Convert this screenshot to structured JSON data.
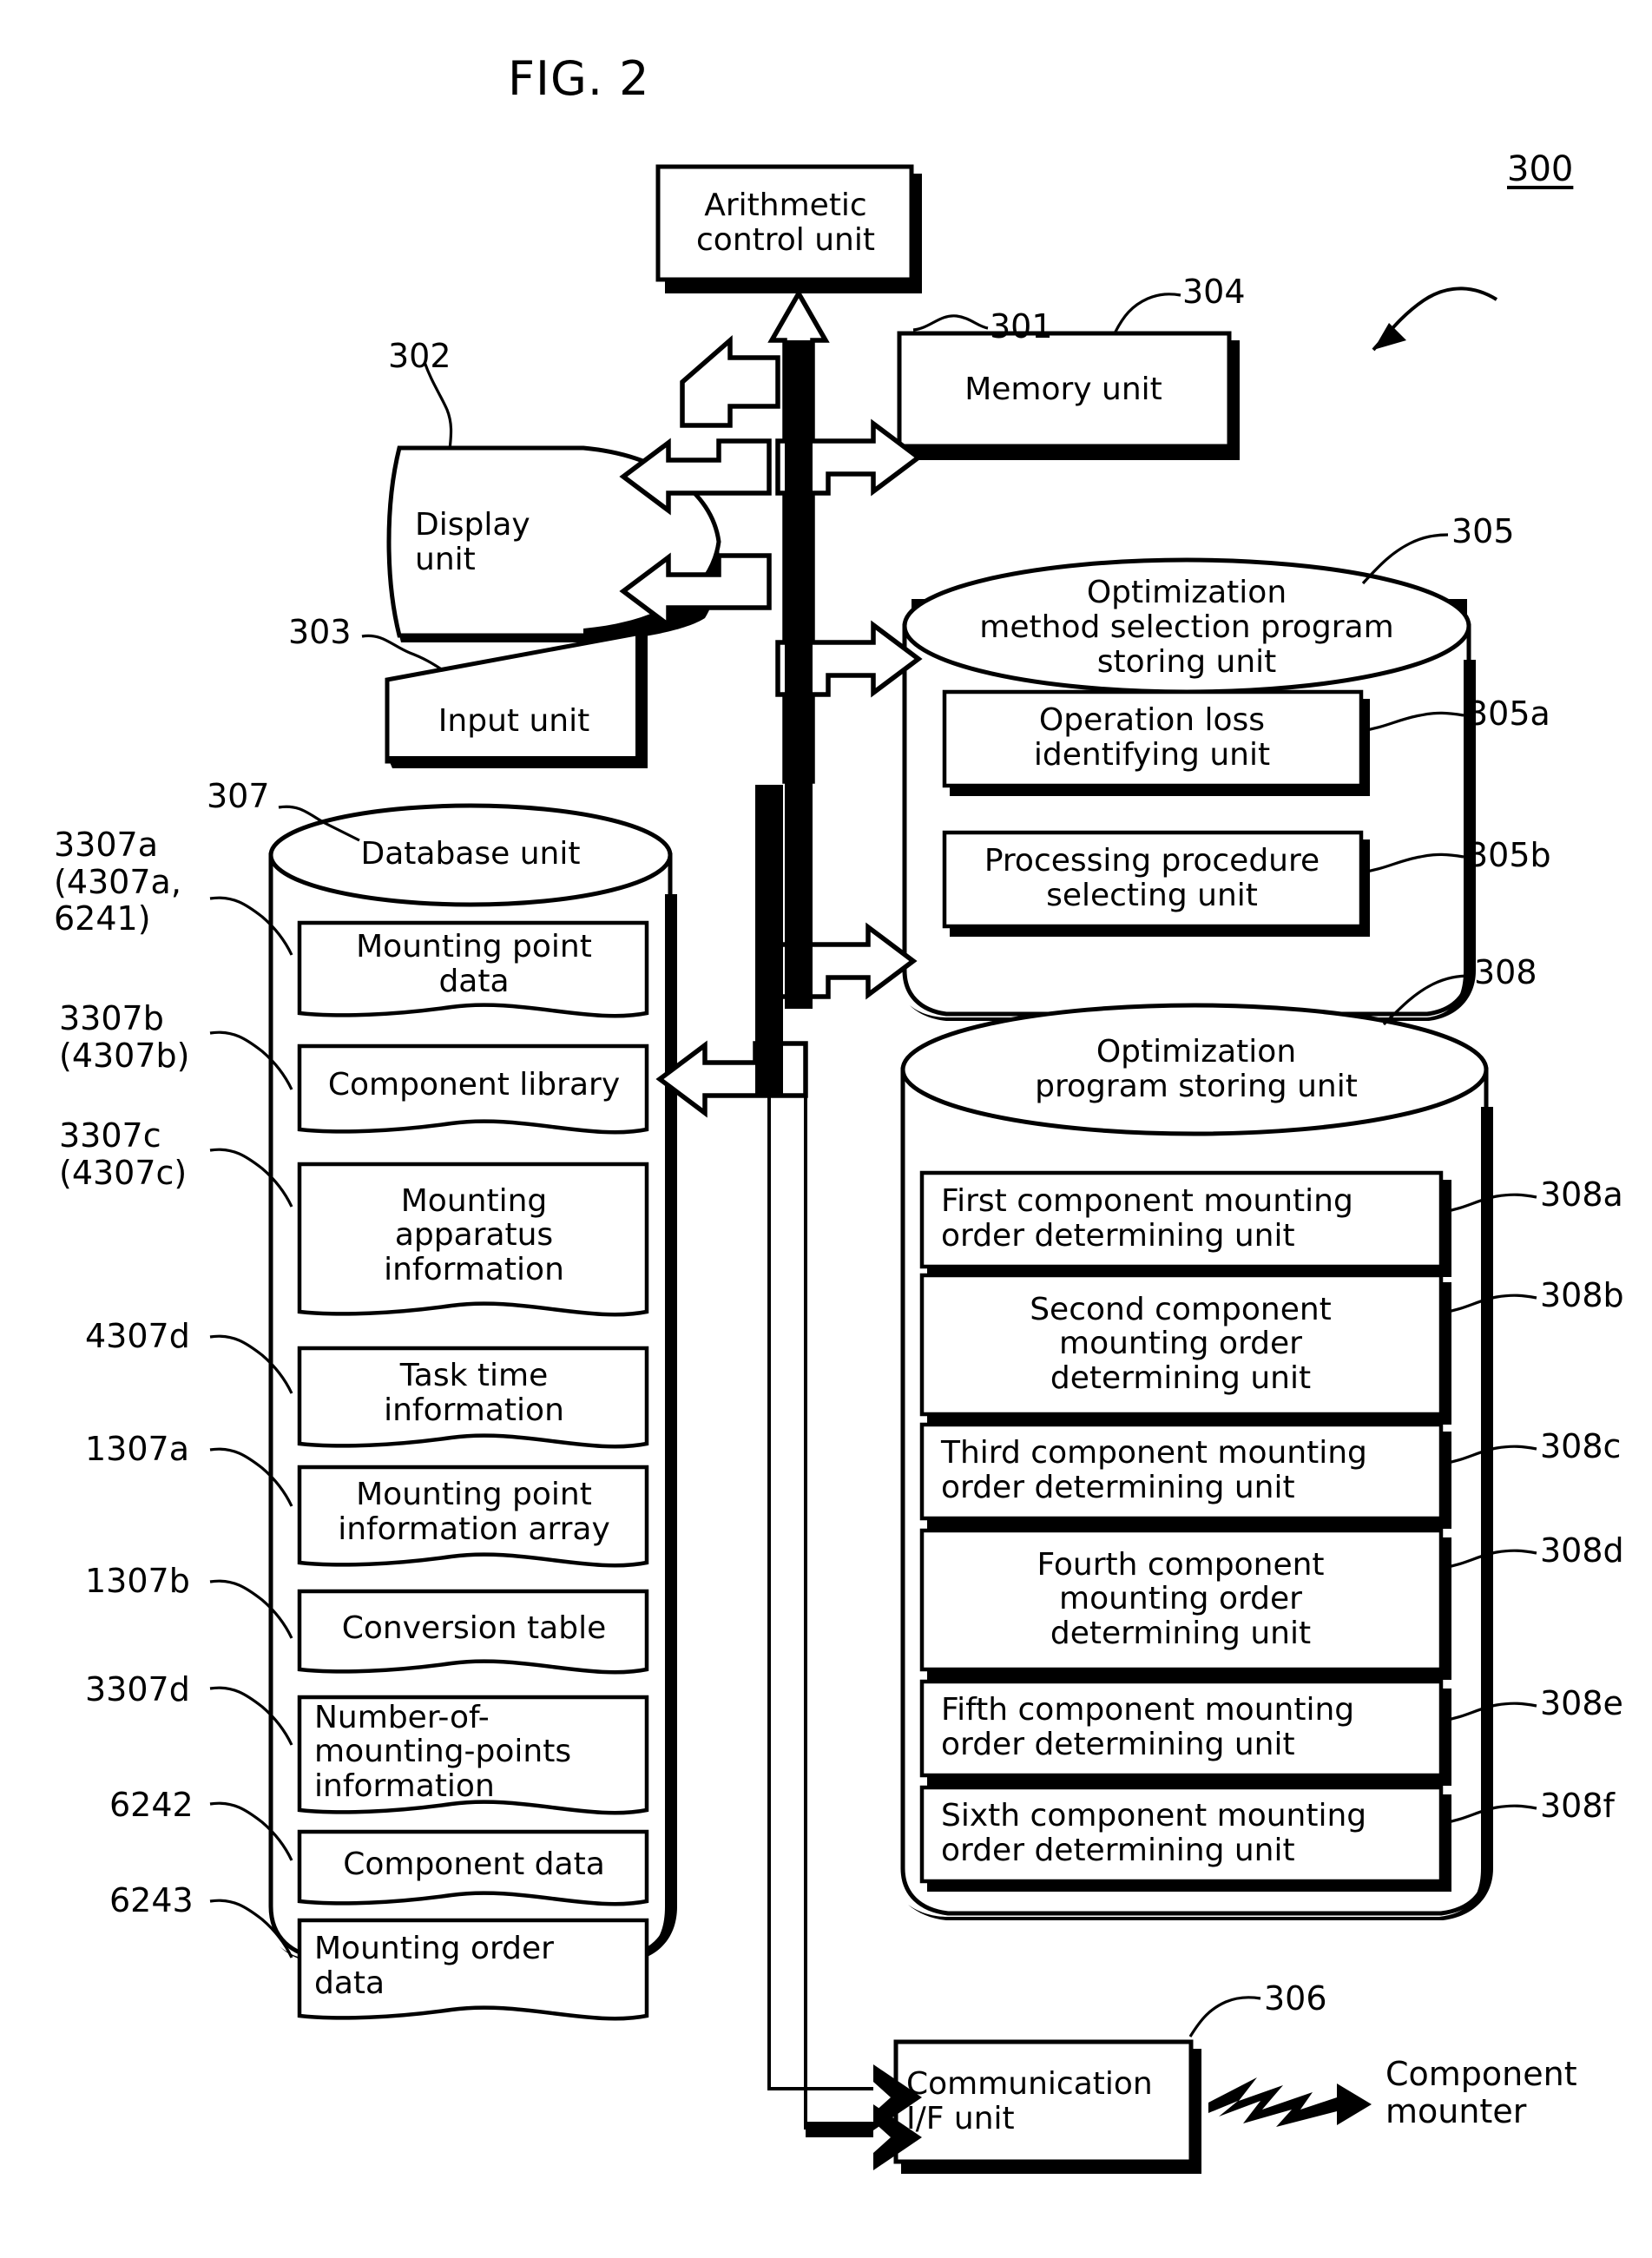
{
  "figure": {
    "title": "FIG. 2",
    "system_ref": "300"
  },
  "nodes": {
    "arithmetic_control_unit": {
      "label": "Arithmetic\ncontrol unit",
      "ref": "301"
    },
    "display_unit": {
      "label": "Display\nunit",
      "ref": "302"
    },
    "input_unit": {
      "label": "Input unit",
      "ref": "303"
    },
    "memory_unit": {
      "label": "Memory unit",
      "ref": "304"
    },
    "communication_if_unit": {
      "label": "Communication\nI/F unit",
      "ref": "306"
    },
    "component_mounter": {
      "label": "Component\nmounter"
    },
    "database_unit": {
      "label": "Database unit",
      "ref": "307",
      "items": [
        {
          "label": "Mounting point\ndata",
          "ref": "3307a\n(4307a,\n6241)"
        },
        {
          "label": "Component library",
          "ref": "3307b\n(4307b)"
        },
        {
          "label": "Mounting\napparatus\ninformation",
          "ref": "3307c\n(4307c)"
        },
        {
          "label": "Task time\ninformation",
          "ref": "4307d"
        },
        {
          "label": "Mounting point\ninformation array",
          "ref": "1307a"
        },
        {
          "label": "Conversion table",
          "ref": "1307b"
        },
        {
          "label": "Number-of-\nmounting-points\ninformation",
          "ref": "3307d"
        },
        {
          "label": "Component data",
          "ref": "6242"
        },
        {
          "label": "Mounting order\ndata",
          "ref": "6243"
        }
      ]
    },
    "optimization_method_selection_program_storing_unit": {
      "label": "Optimization\nmethod selection program\nstoring unit",
      "ref": "305",
      "items": [
        {
          "label": "Operation loss\nidentifying unit",
          "ref": "305a"
        },
        {
          "label": "Processing procedure\nselecting unit",
          "ref": "305b"
        }
      ]
    },
    "optimization_program_storing_unit": {
      "label": "Optimization\nprogram storing unit",
      "ref": "308",
      "items": [
        {
          "label": "First component mounting\norder determining unit",
          "ref": "308a"
        },
        {
          "label": "Second component\nmounting order\ndetermining unit",
          "ref": "308b"
        },
        {
          "label": "Third component mounting\norder determining unit",
          "ref": "308c"
        },
        {
          "label": "Fourth component\nmounting order\ndetermining unit",
          "ref": "308d"
        },
        {
          "label": "Fifth component mounting\norder determining unit",
          "ref": "308e"
        },
        {
          "label": "Sixth component mounting\norder determining unit",
          "ref": "308f"
        }
      ]
    }
  }
}
